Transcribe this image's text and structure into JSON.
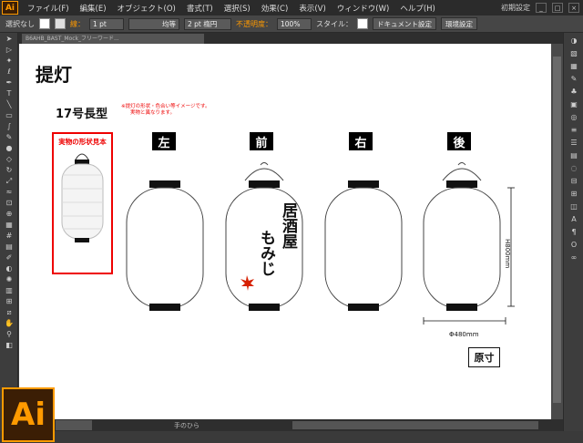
{
  "menubar": {
    "app_logo": "Ai",
    "items": [
      "ファイル(F)",
      "編集(E)",
      "オブジェクト(O)",
      "書式(T)",
      "選択(S)",
      "効果(C)",
      "表示(V)",
      "ウィンドウ(W)",
      "ヘルプ(H)"
    ],
    "workspace": "初期設定"
  },
  "controlbar": {
    "selection": "選択なし",
    "stroke_label": "線：",
    "stroke_weight": "1 pt",
    "line_style": "均等",
    "brush": "2 pt 楕円",
    "opacity_label": "不透明度：",
    "opacity": "100%",
    "style_label": "スタイル：",
    "doc_setup": "ドキュメント設定",
    "prefs": "環境設定"
  },
  "document_tab": "B6AHB_BAST_Mock_フリーワード...",
  "status": {
    "tool": "手のひら"
  },
  "artboard": {
    "title": "提灯",
    "size": "17号長型",
    "note_line1": "※提灯の形状・色合い等イメージです。",
    "note_line2": "実物と異なります。",
    "sample_title": "実物の形状見本",
    "views": [
      "左",
      "前",
      "右",
      "後"
    ],
    "front_text_1": "居酒屋",
    "front_text_2": "もみじ",
    "width_dim": "Φ480mm",
    "height_dim": "H800mm",
    "scale_label": "原寸"
  },
  "colors": {
    "accent": "#ff9a00",
    "note_red": "#e00000"
  },
  "tools": [
    "select",
    "direct-select",
    "magic-wand",
    "lasso",
    "pen",
    "type",
    "line",
    "rect",
    "paintbrush",
    "pencil",
    "blob-brush",
    "eraser",
    "rotate",
    "scale",
    "width",
    "free-transform",
    "shape-builder",
    "perspective",
    "mesh",
    "gradient",
    "eyedropper",
    "blend",
    "symbol-sprayer",
    "column-graph",
    "artboard",
    "slice",
    "hand",
    "zoom"
  ],
  "panel_icons": [
    "color",
    "color-guide",
    "swatches",
    "brushes",
    "symbols",
    "graphic-styles",
    "appearance",
    "layers",
    "stroke",
    "gradient",
    "transparency",
    "align",
    "transform",
    "pathfinder",
    "character",
    "paragraph",
    "opentype",
    "links"
  ]
}
